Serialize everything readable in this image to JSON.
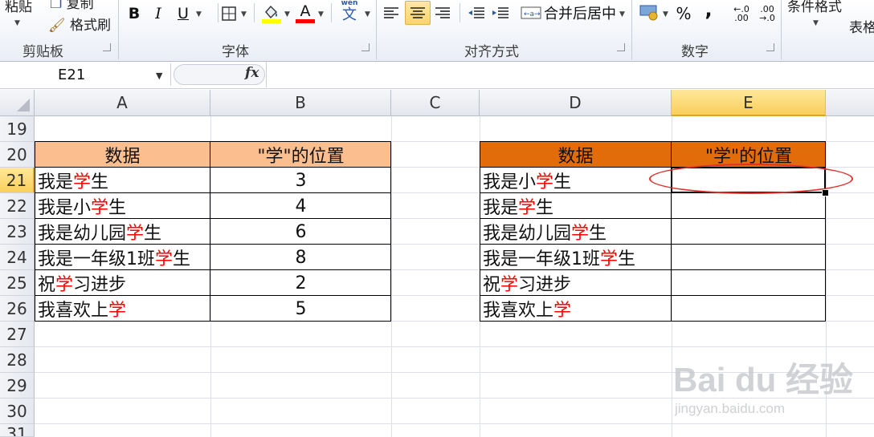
{
  "ribbon": {
    "clipboard": {
      "paste": "粘贴",
      "copy": "复制",
      "format_painter": "格式刷",
      "label": "剪贴板"
    },
    "font": {
      "bold": "B",
      "italic": "I",
      "underline": "U",
      "font_color": "A",
      "phonetic": "wén",
      "phonetic_char": "文",
      "label": "字体"
    },
    "alignment": {
      "merge_center": "合并后居中",
      "label": "对齐方式"
    },
    "number": {
      "percent": "%",
      "comma": ",",
      "label": "数字"
    },
    "styles": {
      "conditional_format": "条件格式",
      "table_format": "表格"
    }
  },
  "formula_bar": {
    "name_box": "E21",
    "fx_label": "fx",
    "formula": ""
  },
  "columns": [
    "A",
    "B",
    "C",
    "D",
    "E"
  ],
  "rows": [
    "19",
    "20",
    "21",
    "22",
    "23",
    "24",
    "25",
    "26",
    "27",
    "28",
    "29",
    "30",
    "31"
  ],
  "table_left": {
    "headers": {
      "data": "数据",
      "pos": "\"学\"的位置"
    },
    "rows": [
      {
        "pre": "我是",
        "hl": "学",
        "post": "生",
        "pos": "3"
      },
      {
        "pre": "我是小",
        "hl": "学",
        "post": "生",
        "pos": "4"
      },
      {
        "pre": "我是幼儿园",
        "hl": "学",
        "post": "生",
        "pos": "6"
      },
      {
        "pre": "我是一年级1班",
        "hl": "学",
        "post": "生",
        "pos": "8"
      },
      {
        "pre": "祝",
        "hl": "学",
        "post": "习进步",
        "pos": "2"
      },
      {
        "pre": "我喜欢上",
        "hl": "学",
        "post": "",
        "pos": "5"
      }
    ]
  },
  "table_right": {
    "headers": {
      "data": "数据",
      "pos": "\"学\"的位置"
    },
    "rows": [
      {
        "pre": "我是小",
        "hl": "学",
        "post": "生"
      },
      {
        "pre": "我是",
        "hl": "学",
        "post": "生"
      },
      {
        "pre": "我是幼儿园",
        "hl": "学",
        "post": "生"
      },
      {
        "pre": "我是一年级1班",
        "hl": "学",
        "post": "生"
      },
      {
        "pre": "祝",
        "hl": "学",
        "post": "习进步"
      },
      {
        "pre": "我喜欢上",
        "hl": "学",
        "post": ""
      }
    ]
  },
  "watermark": {
    "logo": "Bai du 经验",
    "url": "jingyan.baidu.com"
  },
  "colors": {
    "header_light": "#fbbf8f",
    "header_dark": "#e36c0a",
    "highlight": "#ff0000",
    "oval": "#e0312e"
  }
}
